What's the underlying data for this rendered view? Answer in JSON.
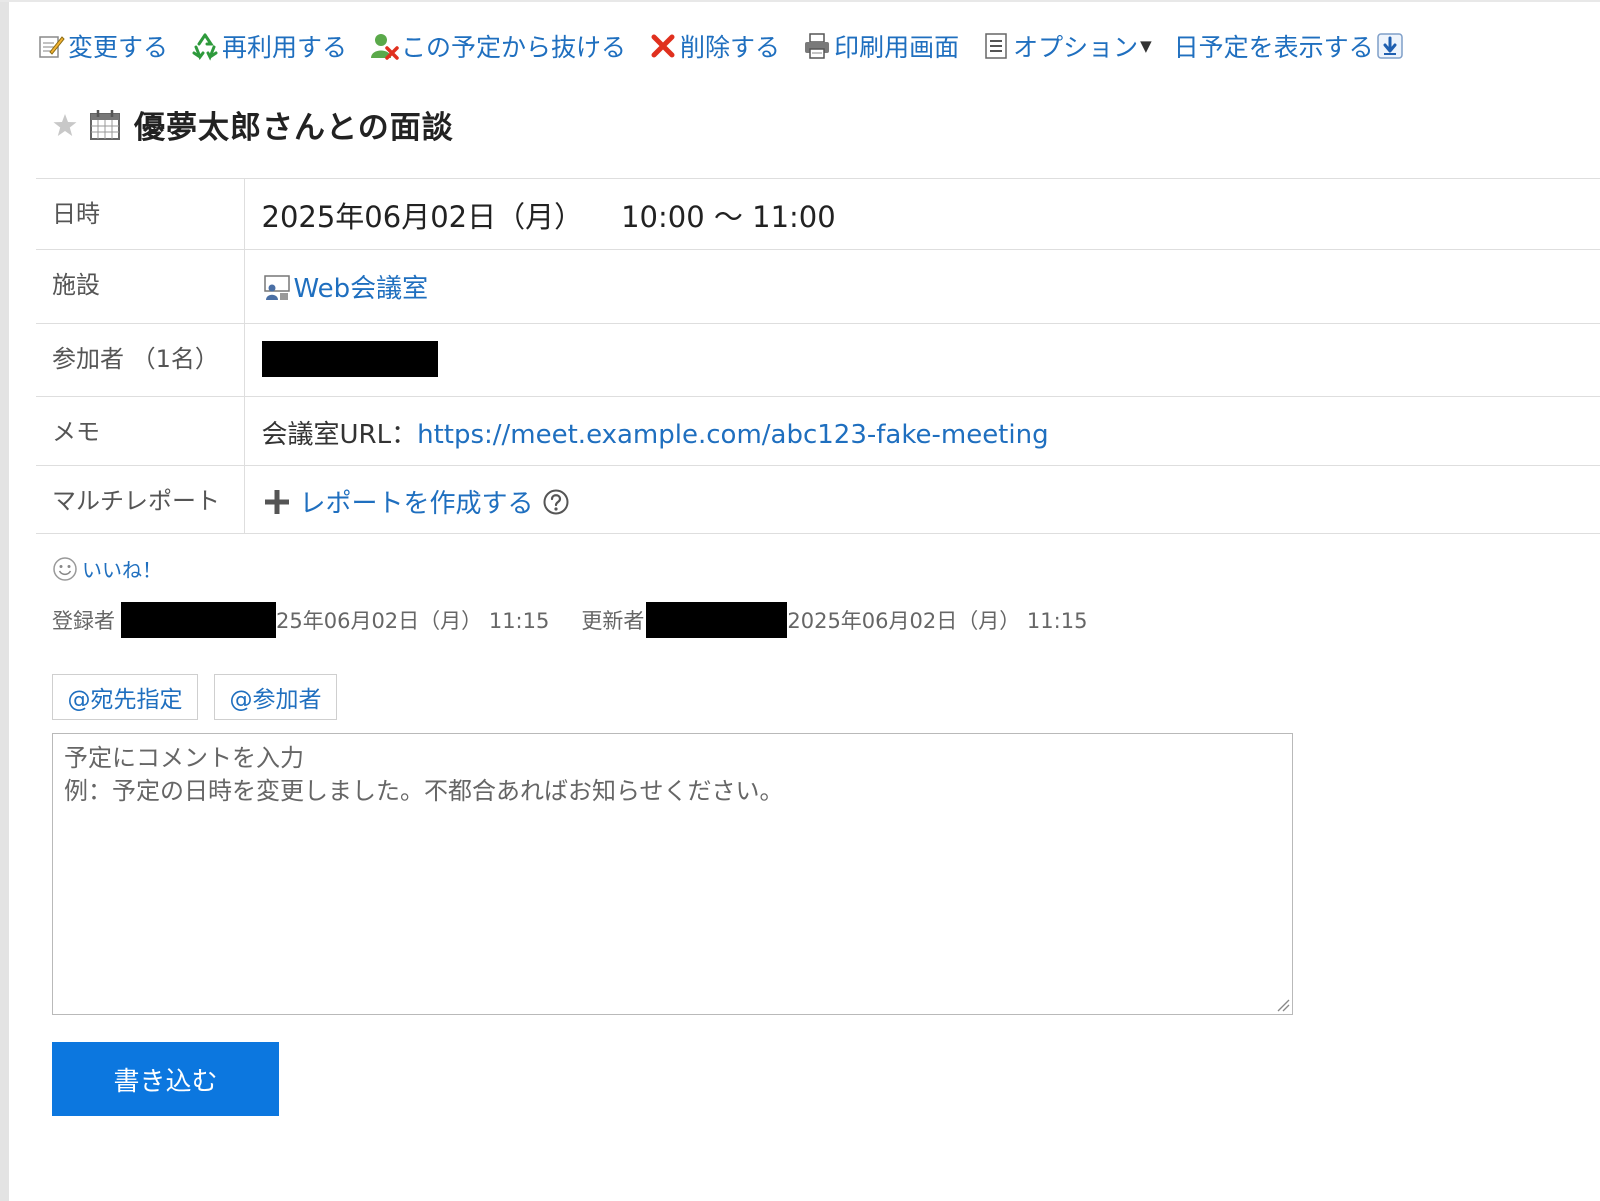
{
  "toolbar": {
    "items": [
      {
        "label": "変更する",
        "icon": "edit-icon"
      },
      {
        "label": "再利用する",
        "icon": "recycle-icon"
      },
      {
        "label": "この予定から抜ける",
        "icon": "leave-user-icon"
      },
      {
        "label": "削除する",
        "icon": "delete-icon"
      },
      {
        "label": "印刷用画面",
        "icon": "print-icon"
      },
      {
        "label": "オプション",
        "icon": "options-list-icon"
      },
      {
        "label": "日予定を表示する",
        "icon": "download-arrow-icon"
      }
    ]
  },
  "title": "優夢太郎さんとの面談",
  "details": {
    "date_label": "日時",
    "date_value": "2025年06月02日（月）",
    "time_value": "10:00 ～ 11:00",
    "facility_label": "施設",
    "facility_value": "Web会議室",
    "participants_label": "参加者 （1名）",
    "memo_label": "メモ",
    "memo_prefix": "会議室URL：",
    "memo_link": "https://meet.example.com/abc123-fake-meeting",
    "multi_label": "マルチレポート",
    "multi_action": "レポートを作成する"
  },
  "like_label": "いいね！",
  "meta": {
    "registrant_label": "登録者",
    "registered_at": "25年06月02日（月） 11:15",
    "updater_label": "更新者",
    "updated_at": "2025年06月02日（月） 11:15"
  },
  "mentions": {
    "address": "@宛先指定",
    "participants": "@参加者"
  },
  "comment": {
    "placeholder": "予定にコメントを入力\n例：予定の日時を変更しました。不都合あればお知らせください。"
  },
  "submit_label": "書き込む",
  "colors": {
    "link": "#1f6fbf",
    "primary_button": "#0c77df",
    "delete": "#e0301e"
  }
}
